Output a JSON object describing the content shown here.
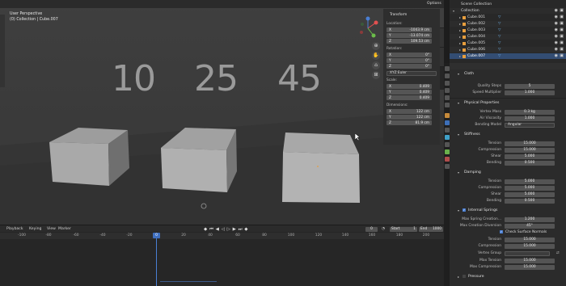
{
  "viewport": {
    "mode_title": "User Perspective",
    "context": "(0) Collection | Cube.007",
    "options_label": "Options",
    "numbers": [
      "10",
      "25",
      "45"
    ]
  },
  "npanel": {
    "tab_label": "Transform",
    "location_label": "Location:",
    "location": [
      {
        "axis": "X",
        "value": "-1043.9 cm"
      },
      {
        "axis": "Y",
        "value": "-13.074 cm"
      },
      {
        "axis": "Z",
        "value": "109.53 cm"
      }
    ],
    "rotation_label": "Rotation:",
    "rotation": [
      {
        "axis": "X",
        "value": "0°"
      },
      {
        "axis": "Y",
        "value": "0°"
      },
      {
        "axis": "Z",
        "value": "0°"
      }
    ],
    "rotation_mode": "XYZ Euler",
    "scale_label": "Scale:",
    "scale": [
      {
        "axis": "X",
        "value": "0.409"
      },
      {
        "axis": "Y",
        "value": "0.409"
      },
      {
        "axis": "Z",
        "value": "0.409"
      }
    ],
    "dimensions_label": "Dimensions:",
    "dimensions": [
      {
        "axis": "X",
        "value": "122 cm"
      },
      {
        "axis": "Y",
        "value": "122 cm"
      },
      {
        "axis": "Z",
        "value": "81.9 cm"
      }
    ]
  },
  "timeline": {
    "menus": [
      "Playback",
      "Keying",
      "View",
      "Marker"
    ],
    "current_frame": "0",
    "start_label": "Start",
    "start_value": "1",
    "end_label": "End",
    "end_value": "1000",
    "ruler": [
      "-100",
      "-80",
      "-60",
      "-40",
      "-20",
      "0",
      "20",
      "40",
      "60",
      "80",
      "100",
      "120",
      "140",
      "160",
      "180",
      "200"
    ],
    "playhead": "0"
  },
  "outliner": {
    "scene_collection": "Scene Collection",
    "collection": "Collection",
    "items": [
      "Cube.001",
      "Cube.002",
      "Cube.003",
      "Cube.004",
      "Cube.005",
      "Cube.006",
      "Cube.007"
    ]
  },
  "properties": {
    "cloth_title": "Cloth",
    "quality_steps_label": "Quality Steps",
    "quality_steps": "5",
    "speed_multiplier_label": "Speed Multiplier",
    "speed_multiplier": "1.000",
    "physical_title": "Physical Properties",
    "vertex_mass_label": "Vertex Mass",
    "vertex_mass": "0.3 kg",
    "air_viscosity_label": "Air Viscosity",
    "air_viscosity": "1.000",
    "bending_model_label": "Bending Model",
    "bending_model": "Angular",
    "stiffness_title": "Stiffness",
    "stiff_tension_label": "Tension",
    "stiff_tension": "15.000",
    "stiff_compression_label": "Compression",
    "stiff_compression": "15.000",
    "stiff_shear_label": "Shear",
    "stiff_shear": "5.000",
    "stiff_bending_label": "Bending",
    "stiff_bending": "0.500",
    "damping_title": "Damping",
    "damp_tension_label": "Tension",
    "damp_tension": "5.000",
    "damp_compression_label": "Compression",
    "damp_compression": "5.000",
    "damp_shear_label": "Shear",
    "damp_shear": "5.000",
    "damp_bending_label": "Bending",
    "damp_bending": "0.500",
    "internal_springs_title": "Internal Springs",
    "max_spring_label": "Max Spring Creation...",
    "max_spring": "1.200",
    "max_creation_diversion_label": "Max Creation Diversion",
    "max_creation_diversion": "45°",
    "check_surface_normals": "Check Surface Normals",
    "int_tension_label": "Tension",
    "int_tension": "15.000",
    "int_compression_label": "Compression",
    "int_compression": "15.000",
    "vertex_group_label": "Vertex Group",
    "max_tension_label": "Max Tension",
    "max_tension": "15.000",
    "max_compression_label": "Max Compression",
    "max_compression": "15.000",
    "pressure_title": "Pressure"
  },
  "colors": {
    "accent": "#4a7fd4",
    "object_orange": "#e89e3d",
    "mesh_cyan": "#6fb2e8"
  }
}
